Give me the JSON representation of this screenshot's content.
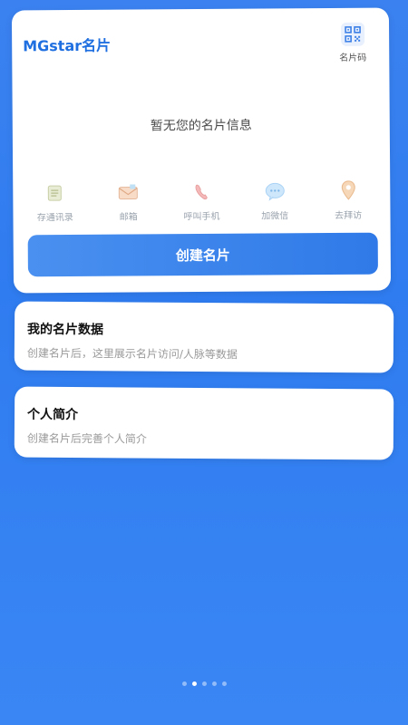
{
  "brand": {
    "title": "MGstar名片"
  },
  "qr": {
    "label": "名片码",
    "icon": "qr-code-icon"
  },
  "empty_state": {
    "text": "暂无您的名片信息"
  },
  "actions": [
    {
      "label": "存通讯录",
      "icon": "contacts-icon"
    },
    {
      "label": "邮箱",
      "icon": "mail-icon"
    },
    {
      "label": "呼叫手机",
      "icon": "phone-icon"
    },
    {
      "label": "加微信",
      "icon": "wechat-icon"
    },
    {
      "label": "去拜访",
      "icon": "location-pin-icon"
    }
  ],
  "create_button": {
    "label": "创建名片"
  },
  "data_card": {
    "title": "我的名片数据",
    "subtitle": "创建名片后，这里展示名片访问/人脉等数据"
  },
  "intro_card": {
    "title": "个人简介",
    "subtitle": "创建名片后完善个人简介"
  },
  "pager": {
    "count": 5,
    "active_index": 1
  },
  "colors": {
    "accent": "#2f7ae8",
    "brand": "#1f6fe0",
    "background": "#3b82f0"
  }
}
